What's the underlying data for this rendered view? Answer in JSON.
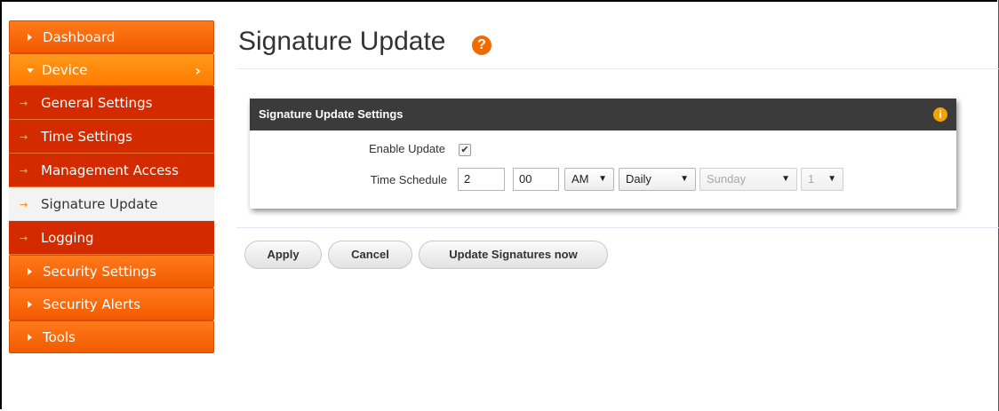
{
  "sidebar": {
    "items": [
      {
        "label": "Dashboard"
      },
      {
        "label": "Device",
        "chevron": "›"
      },
      {
        "label": "General Settings"
      },
      {
        "label": "Time Settings"
      },
      {
        "label": "Management Access"
      },
      {
        "label": "Signature Update"
      },
      {
        "label": "Logging"
      },
      {
        "label": "Security Settings"
      },
      {
        "label": "Security Alerts"
      },
      {
        "label": "Tools"
      }
    ],
    "sub_arrow": "→",
    "active": "Signature Update"
  },
  "page": {
    "title": "Signature Update",
    "help_icon": "?"
  },
  "panel": {
    "header": "Signature Update Settings",
    "info_icon": "i",
    "enable_label": "Enable Update",
    "enable_checked": true,
    "checkmark": "✔",
    "schedule_label": "Time Schedule",
    "hour": "2",
    "minute": "00",
    "ampm": "AM",
    "frequency": "Daily",
    "weekday": "Sunday",
    "day": "1",
    "caret": "▼"
  },
  "buttons": {
    "apply": "Apply",
    "cancel": "Cancel",
    "update_now": "Update Signatures now"
  },
  "colors": {
    "accent": "#f26b00",
    "submenu": "#d42a00",
    "header": "#3b3b3b"
  }
}
